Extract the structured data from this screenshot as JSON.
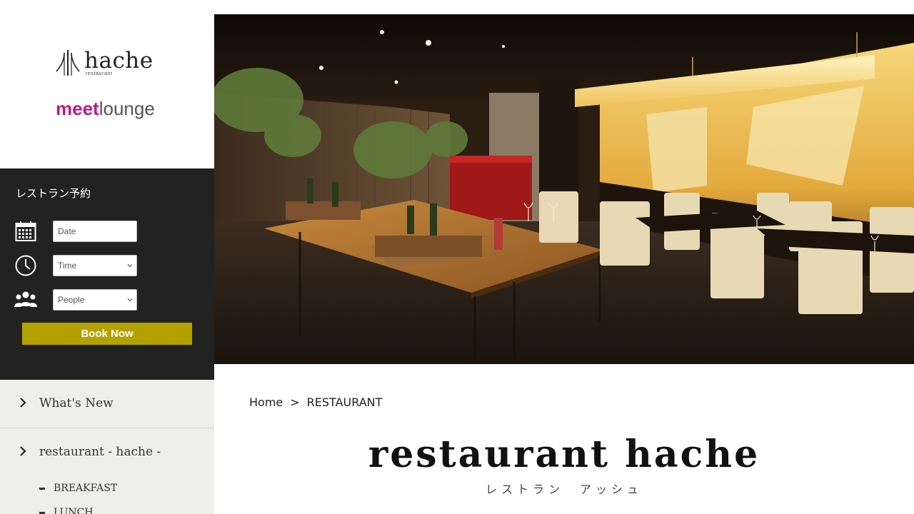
{
  "brand": {
    "hache_name": "hache",
    "hache_sub": "restaurant",
    "meet_part": "meet",
    "lounge_part": "lounge",
    "accent_pink": "#c2187f"
  },
  "reservation": {
    "title": "レストラン予約",
    "date_placeholder": "Date",
    "time_value": "Time",
    "people_value": "People",
    "book_label": "Book Now",
    "book_color": "#b3a100"
  },
  "nav": {
    "items": [
      {
        "label": "What's New"
      },
      {
        "label": "restaurant - hache -"
      }
    ],
    "subitems": [
      {
        "label": "BREAKFAST"
      },
      {
        "label": "LUNCH"
      }
    ]
  },
  "breadcrumb": {
    "home": "Home",
    "separator": ">",
    "current": "RESTAURANT"
  },
  "page": {
    "title": "restaurant hache",
    "subtitle": "レストラン　アッシュ"
  },
  "icons": [
    "calendar-icon",
    "clock-icon",
    "people-icon",
    "chevron-right-icon",
    "chevron-down-icon"
  ]
}
